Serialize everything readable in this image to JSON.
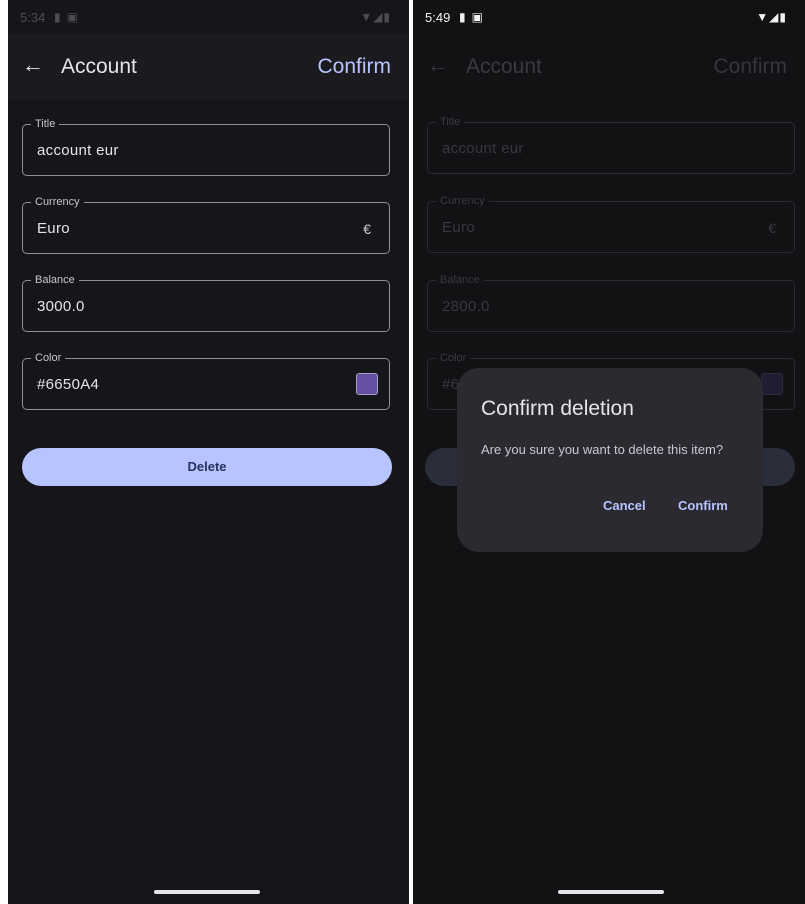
{
  "left_screen": {
    "status": {
      "time": "5:34"
    },
    "appbar": {
      "title": "Account",
      "action": "Confirm"
    },
    "fields": [
      {
        "label": "Title",
        "value": "account eur"
      },
      {
        "label": "Currency",
        "value": "Euro",
        "trailing": "€"
      },
      {
        "label": "Balance",
        "value": "3000.0"
      },
      {
        "label": "Color",
        "value": "#6650A4"
      }
    ],
    "delete_label": "Delete"
  },
  "right_screen": {
    "status": {
      "time": "5:49"
    },
    "appbar": {
      "title": "Account",
      "action": "Confirm"
    },
    "fields": [
      {
        "label": "Title",
        "value": "account eur"
      },
      {
        "label": "Currency",
        "value": "Euro",
        "trailing": "€"
      },
      {
        "label": "Balance",
        "value": "2800.0"
      },
      {
        "label": "Color",
        "value": "#6"
      }
    ],
    "dialog": {
      "title": "Confirm deletion",
      "message": "Are you sure you want to delete this item?",
      "cancel": "Cancel",
      "confirm": "Confirm"
    }
  },
  "colors": {
    "accent": "#B7C4FF",
    "account_color": "#6650A4",
    "background": "#16161A",
    "dialog_surface": "#2B2A30"
  },
  "icons": [
    "back-arrow-icon",
    "wifi-icon",
    "signal-icon",
    "battery-icon",
    "sim-icon",
    "notification-icon",
    "euro-icon"
  ]
}
